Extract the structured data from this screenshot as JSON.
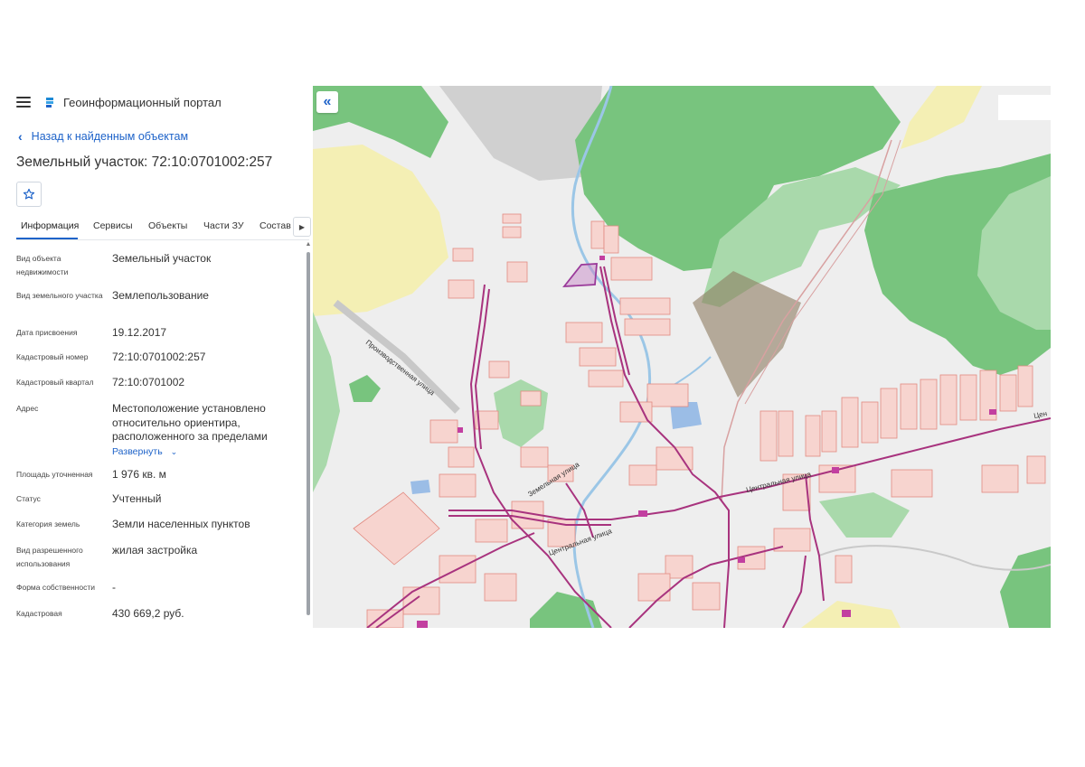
{
  "header": {
    "menu_icon": "hamburger-menu-icon",
    "logo_icon": "portal-logo-icon",
    "title": "Геоинформационный портал"
  },
  "nav": {
    "back_label": "Назад к найденным объектам",
    "back_icon": "chevron-left-icon"
  },
  "object": {
    "title": "Земельный участок: 72:10:0701002:257",
    "favorite_icon": "star-icon"
  },
  "tabs": [
    {
      "label": "Информация",
      "active": true
    },
    {
      "label": "Сервисы",
      "active": false
    },
    {
      "label": "Объекты",
      "active": false
    },
    {
      "label": "Части ЗУ",
      "active": false
    },
    {
      "label": "Состав",
      "active": false
    }
  ],
  "tabs_next_icon": "chevron-right-icon",
  "info_rows": [
    {
      "label": "Вид объекта недвижимости",
      "value": "Земельный участок"
    },
    {
      "label": "Вид земельного участка",
      "value": "Землепользование"
    },
    {
      "label": "Дата присвоения",
      "value": "19.12.2017"
    },
    {
      "label": "Кадастровый номер",
      "value": "72:10:0701002:257"
    },
    {
      "label": "Кадастровый квартал",
      "value": "72:10:0701002"
    },
    {
      "label": "Адрес",
      "value": "Местоположение установлено относительно ориентира, расположенного за пределами",
      "expand_label": "Развернуть"
    },
    {
      "label": "Площадь уточненная",
      "value": "1 976 кв. м"
    },
    {
      "label": "Статус",
      "value": "Учтенный"
    },
    {
      "label": "Категория земель",
      "value": "Земли населенных пунктов"
    },
    {
      "label": "Вид разрешенного использования",
      "value": "жилая застройка"
    },
    {
      "label": "Форма собственности",
      "value": "-"
    },
    {
      "label": "Кадастровая",
      "value": "430 669,2 руб."
    }
  ],
  "map": {
    "collapse_icon": "double-chevron-left-icon",
    "street_labels": [
      "Производственная улица",
      "Центральная улица",
      "Центральная улица",
      "Земельная улица",
      "Цен"
    ],
    "colors": {
      "background": "#eeeeee",
      "forest": "#78c47e",
      "forest_light": "#a9d9ab",
      "field": "#f4efb4",
      "parcel_fill": "#f7d4cf",
      "parcel_stroke": "#e28a80",
      "network": "#a8337e",
      "river": "#9bc6e6",
      "selected_parcel": "#9a3a9a",
      "industrial": "#d0d0d0",
      "accent": "#1e63c9"
    }
  }
}
